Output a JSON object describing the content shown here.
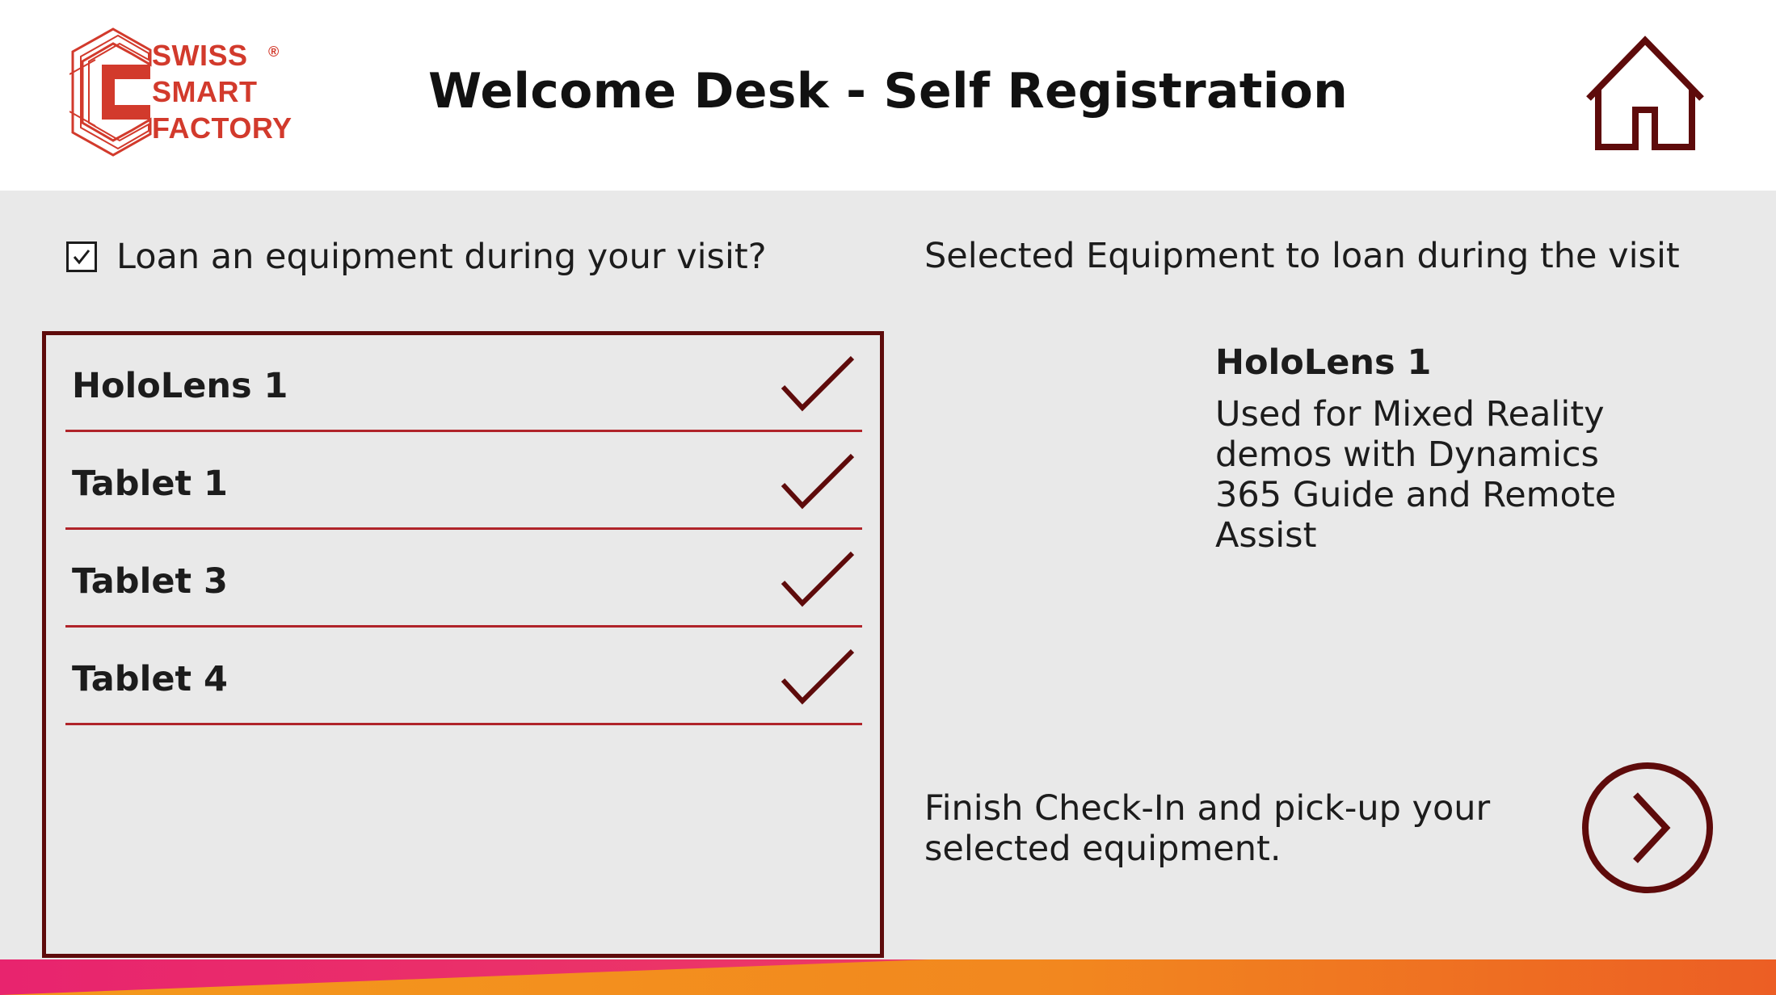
{
  "header": {
    "logo": {
      "lines": [
        "SWISS",
        "SMART",
        "FACTORY"
      ],
      "registered_mark": "®",
      "color": "#d23a2c"
    },
    "title": "Welcome Desk - Self Registration",
    "home_icon": "home-icon"
  },
  "loan": {
    "checked": true,
    "label": "Loan an equipment during your visit?"
  },
  "equipment_list": {
    "items": [
      {
        "name": "HoloLens 1",
        "selected": true
      },
      {
        "name": "Tablet 1",
        "selected": true
      },
      {
        "name": "Tablet 3",
        "selected": true
      },
      {
        "name": "Tablet 4",
        "selected": true
      }
    ]
  },
  "selected": {
    "section_title": "Selected Equipment to loan during the visit",
    "name": "HoloLens 1",
    "description": "Used for Mixed Reality demos with Dynamics 365 Guide and Remote Assist"
  },
  "finish": {
    "text": "Finish Check-In and pick-up your selected equipment.",
    "next_icon": "chevron-right-circle-icon"
  },
  "colors": {
    "accent": "#5e0b0b",
    "divider": "#b0242a",
    "background": "#e9e9e9",
    "header_background": "#ffffff",
    "bar_pink": "#e8246e",
    "bar_orange": "#f28b1e"
  }
}
